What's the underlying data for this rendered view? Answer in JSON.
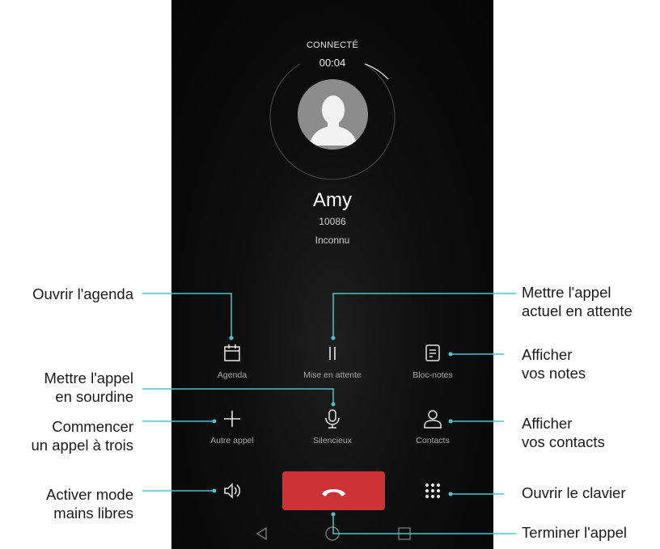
{
  "call": {
    "status": "CONNECTÉ",
    "timer": "00:04",
    "caller_name": "Amy",
    "caller_number": "10086",
    "caller_tag": "Inconnu"
  },
  "controls": {
    "agenda": {
      "label": "Agenda",
      "icon": "calendar-icon"
    },
    "hold": {
      "label": "Mise en attente",
      "icon": "pause-icon"
    },
    "notes": {
      "label": "Bloc-notes",
      "icon": "notepad-icon"
    },
    "add_call": {
      "label": "Autre appel",
      "icon": "plus-icon"
    },
    "mute": {
      "label": "Silencieux",
      "icon": "microphone-icon"
    },
    "contacts": {
      "label": "Contacts",
      "icon": "person-icon"
    },
    "speaker": {
      "icon": "speaker-icon"
    },
    "end_call": {
      "icon": "hang-up-icon"
    },
    "dialpad": {
      "icon": "dialpad-icon"
    }
  },
  "nav": {
    "back": "back-triangle-icon",
    "home": "home-circle-icon",
    "recents": "recents-square-icon"
  },
  "annotations": {
    "open_agenda": "Ouvrir l'agenda",
    "hold_l1": "Mettre l'appel",
    "hold_l2": "actuel en attente",
    "mute_l1": "Mettre l'appel",
    "mute_l2": "en sourdine",
    "notes_l1": "Afficher",
    "notes_l2": "vos notes",
    "three_way_l1": "Commencer",
    "three_way_l2": "un appel à trois",
    "contacts_l1": "Afficher",
    "contacts_l2": "vos contacts",
    "speaker_l1": "Activer mode",
    "speaker_l2": "mains libres",
    "dialpad": "Ouvrir le clavier",
    "end_call": "Terminer l'appel"
  },
  "colors": {
    "end_call": "#cc3236",
    "callout_line": "#4cc3c8",
    "screen_bg": "#0e0e0e"
  }
}
